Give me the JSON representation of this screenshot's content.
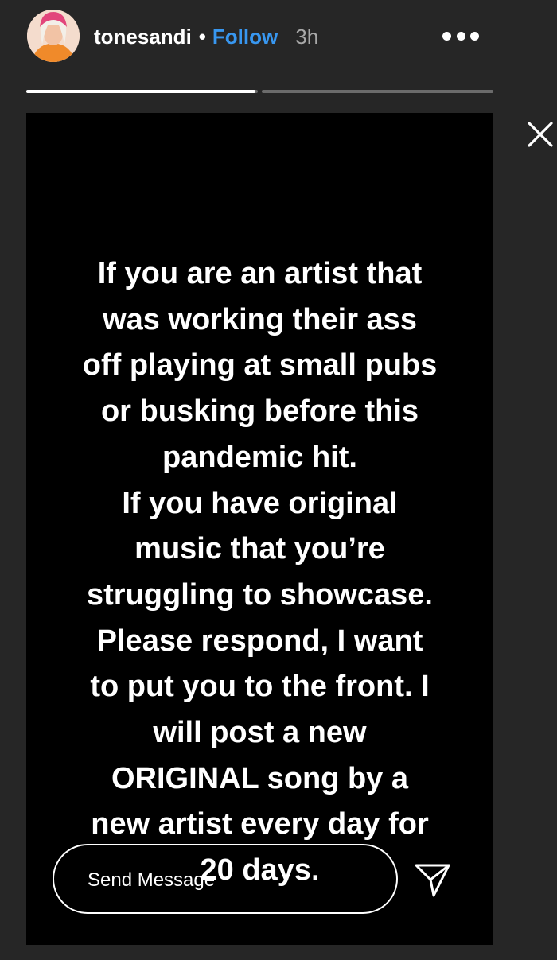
{
  "header": {
    "username": "tonesandi",
    "separator": "•",
    "follow_label": "Follow",
    "time_ago": "3h",
    "avatar_icon": "profile-avatar",
    "more_icon": "more-options-icon",
    "close_icon": "close-icon"
  },
  "progress": {
    "segments": [
      {
        "fill": 0.99
      },
      {
        "fill": 0
      }
    ]
  },
  "story": {
    "text": "If you are an artist that\nwas working their ass\noff playing at small pubs\nor busking before this\npandemic hit.\nIf you have original\nmusic that you’re\nstruggling to showcase.\nPlease respond, I want\nto put you to the front. I\nwill post a new\nORIGINAL song by a\nnew artist every day for\n20 days."
  },
  "reply": {
    "placeholder": "Send Message",
    "value": "",
    "send_icon": "send-icon"
  },
  "colors": {
    "background": "#262626",
    "story_background": "#000000",
    "accent": "#3897f0",
    "muted": "#a8a8a8"
  }
}
